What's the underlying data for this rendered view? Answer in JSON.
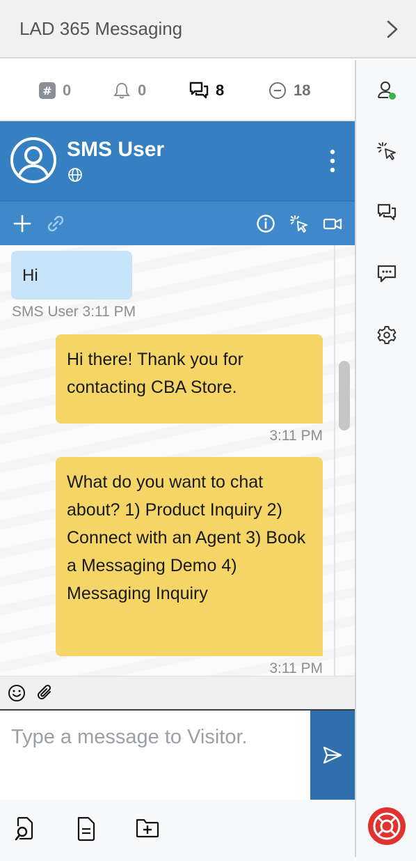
{
  "app": {
    "title": "LAD 365 Messaging"
  },
  "counters": [
    {
      "icon": "hash-icon",
      "value": "0"
    },
    {
      "icon": "bell-icon",
      "value": "0"
    },
    {
      "icon": "chats-icon",
      "value": "8"
    },
    {
      "icon": "minus-circle-icon",
      "value": "18"
    }
  ],
  "chat": {
    "user_name": "SMS User",
    "header_color": "#3680c1"
  },
  "messages": [
    {
      "direction": "in",
      "text": "Hi",
      "sender": "SMS User",
      "time": "3:11 PM",
      "meta": "SMS User 3:11 PM"
    },
    {
      "direction": "out",
      "text": "Hi there! Thank you for contacting CBA Store.",
      "time": "3:11 PM"
    },
    {
      "direction": "out",
      "text": "What do you want to chat about? 1) Product Inquiry 2) Connect with an Agent 3) Book a Messaging Demo 4) Messaging Inquiry",
      "time": "3:11 PM"
    }
  ],
  "composer": {
    "placeholder": "Type a message to Visitor."
  },
  "colors": {
    "incoming_bubble": "#c8e4f8",
    "outgoing_bubble": "#f5d565",
    "send_button": "#2f6fad",
    "status_online": "#3cb44b",
    "help_button": "#e0322f"
  }
}
